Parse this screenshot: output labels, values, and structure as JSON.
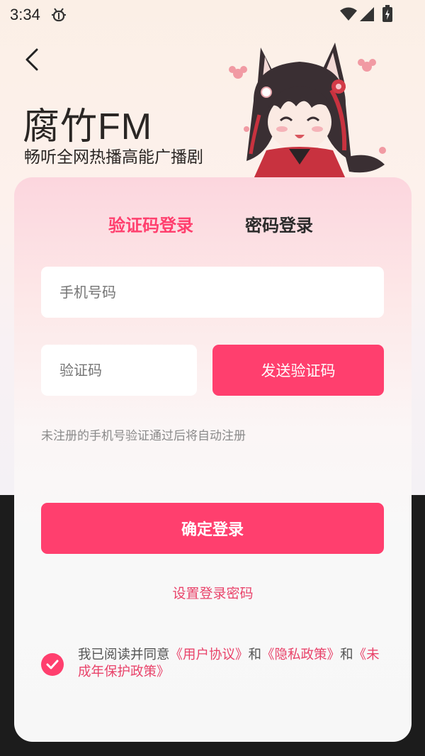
{
  "status_bar": {
    "time": "3:34"
  },
  "header": {
    "title": "腐竹FM",
    "subtitle": "畅听全网热播高能广播剧"
  },
  "tabs": {
    "sms_login": "验证码登录",
    "password_login": "密码登录"
  },
  "form": {
    "phone_placeholder": "手机号码",
    "code_placeholder": "验证码",
    "send_code": "发送验证码",
    "hint": "未注册的手机号验证通过后将自动注册",
    "submit": "确定登录",
    "set_password": "设置登录密码"
  },
  "agreement": {
    "prefix": "我已阅读并同意",
    "user_agreement": "《用户协议》",
    "and1": "和",
    "privacy_policy": "《隐私政策》",
    "and2": "和",
    "minor_policy": "《未成年保护政策》",
    "checked": true
  },
  "colors": {
    "accent": "#ff3f6e",
    "link": "#e9436a"
  }
}
